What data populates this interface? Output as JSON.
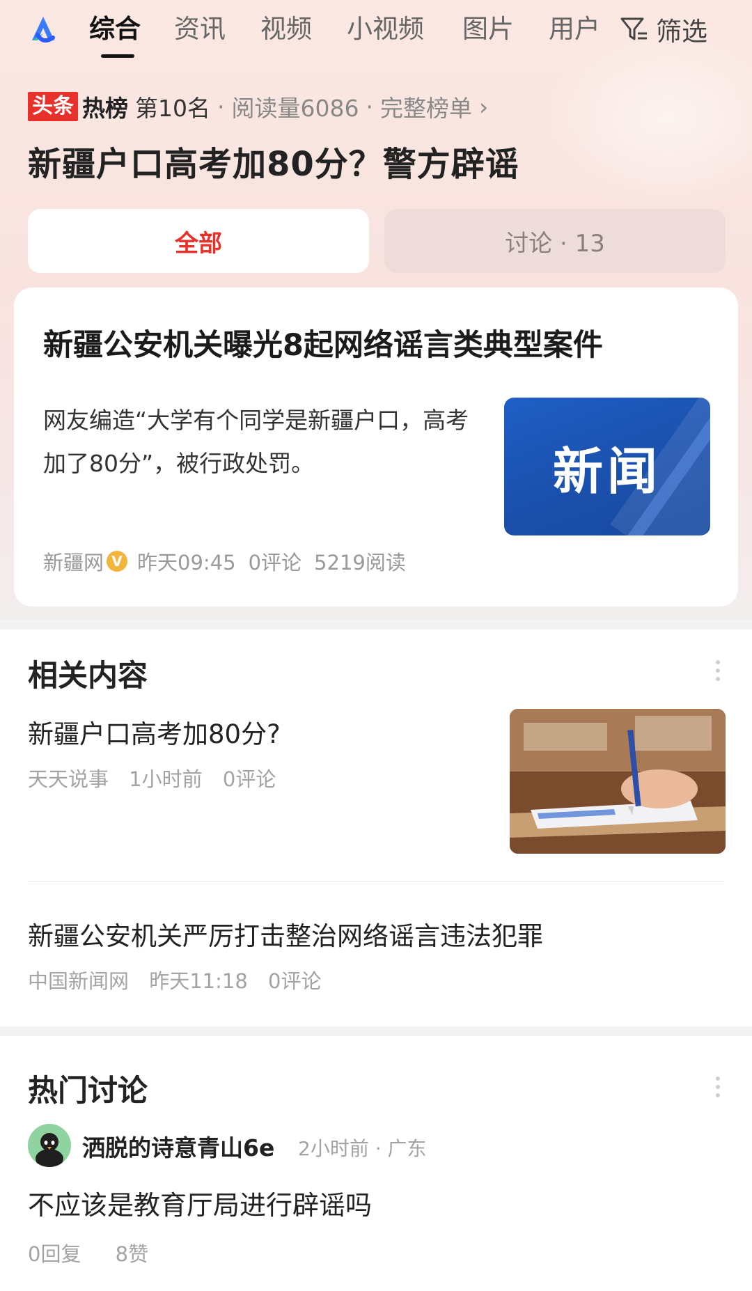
{
  "nav": {
    "tabs": [
      "综合",
      "资讯",
      "视频",
      "小视频",
      "图片",
      "用户"
    ],
    "active_tab": 0,
    "filter_label": "筛选"
  },
  "hot": {
    "badge_left": "头条",
    "badge_right": "热榜",
    "rank": "第10名",
    "reads": "阅读量6086",
    "full_list": "完整榜单",
    "topic_title": "新疆户口高考加80分？警方辟谣"
  },
  "segments": {
    "all": "全部",
    "discussion": "讨论 · 13"
  },
  "news_card": {
    "title": "新疆公安机关曝光8起网络谣言类典型案件",
    "description": "网友编造“大学有个同学是新疆户口，高考加了80分”，被行政处罚。",
    "thumbnail_text": "新闻",
    "source": "新疆网",
    "verified_mark": "V",
    "time": "昨天09:45",
    "comments": "0评论",
    "reads": "5219阅读",
    "thumb_color": "#1a4fab"
  },
  "related": {
    "section_title": "相关内容",
    "items": [
      {
        "title": "新疆户口高考加80分?",
        "source": "天天说事",
        "time": "1小时前",
        "comments": "0评论"
      },
      {
        "title": "新疆公安机关严厉打击整治网络谣言违法犯罪",
        "source": "中国新闻网",
        "time": "昨天11:18",
        "comments": "0评论"
      }
    ]
  },
  "discussion": {
    "section_title": "热门讨论",
    "user": "洒脱的诗意青山6e",
    "meta": "2小时前 · 广东",
    "comment": "不应该是教育厅局进行辟谣吗",
    "replies": "0回复",
    "likes": "8赞"
  },
  "colors": {
    "accent_red": "#e8312a",
    "verified_yellow": "#f2b43a"
  }
}
